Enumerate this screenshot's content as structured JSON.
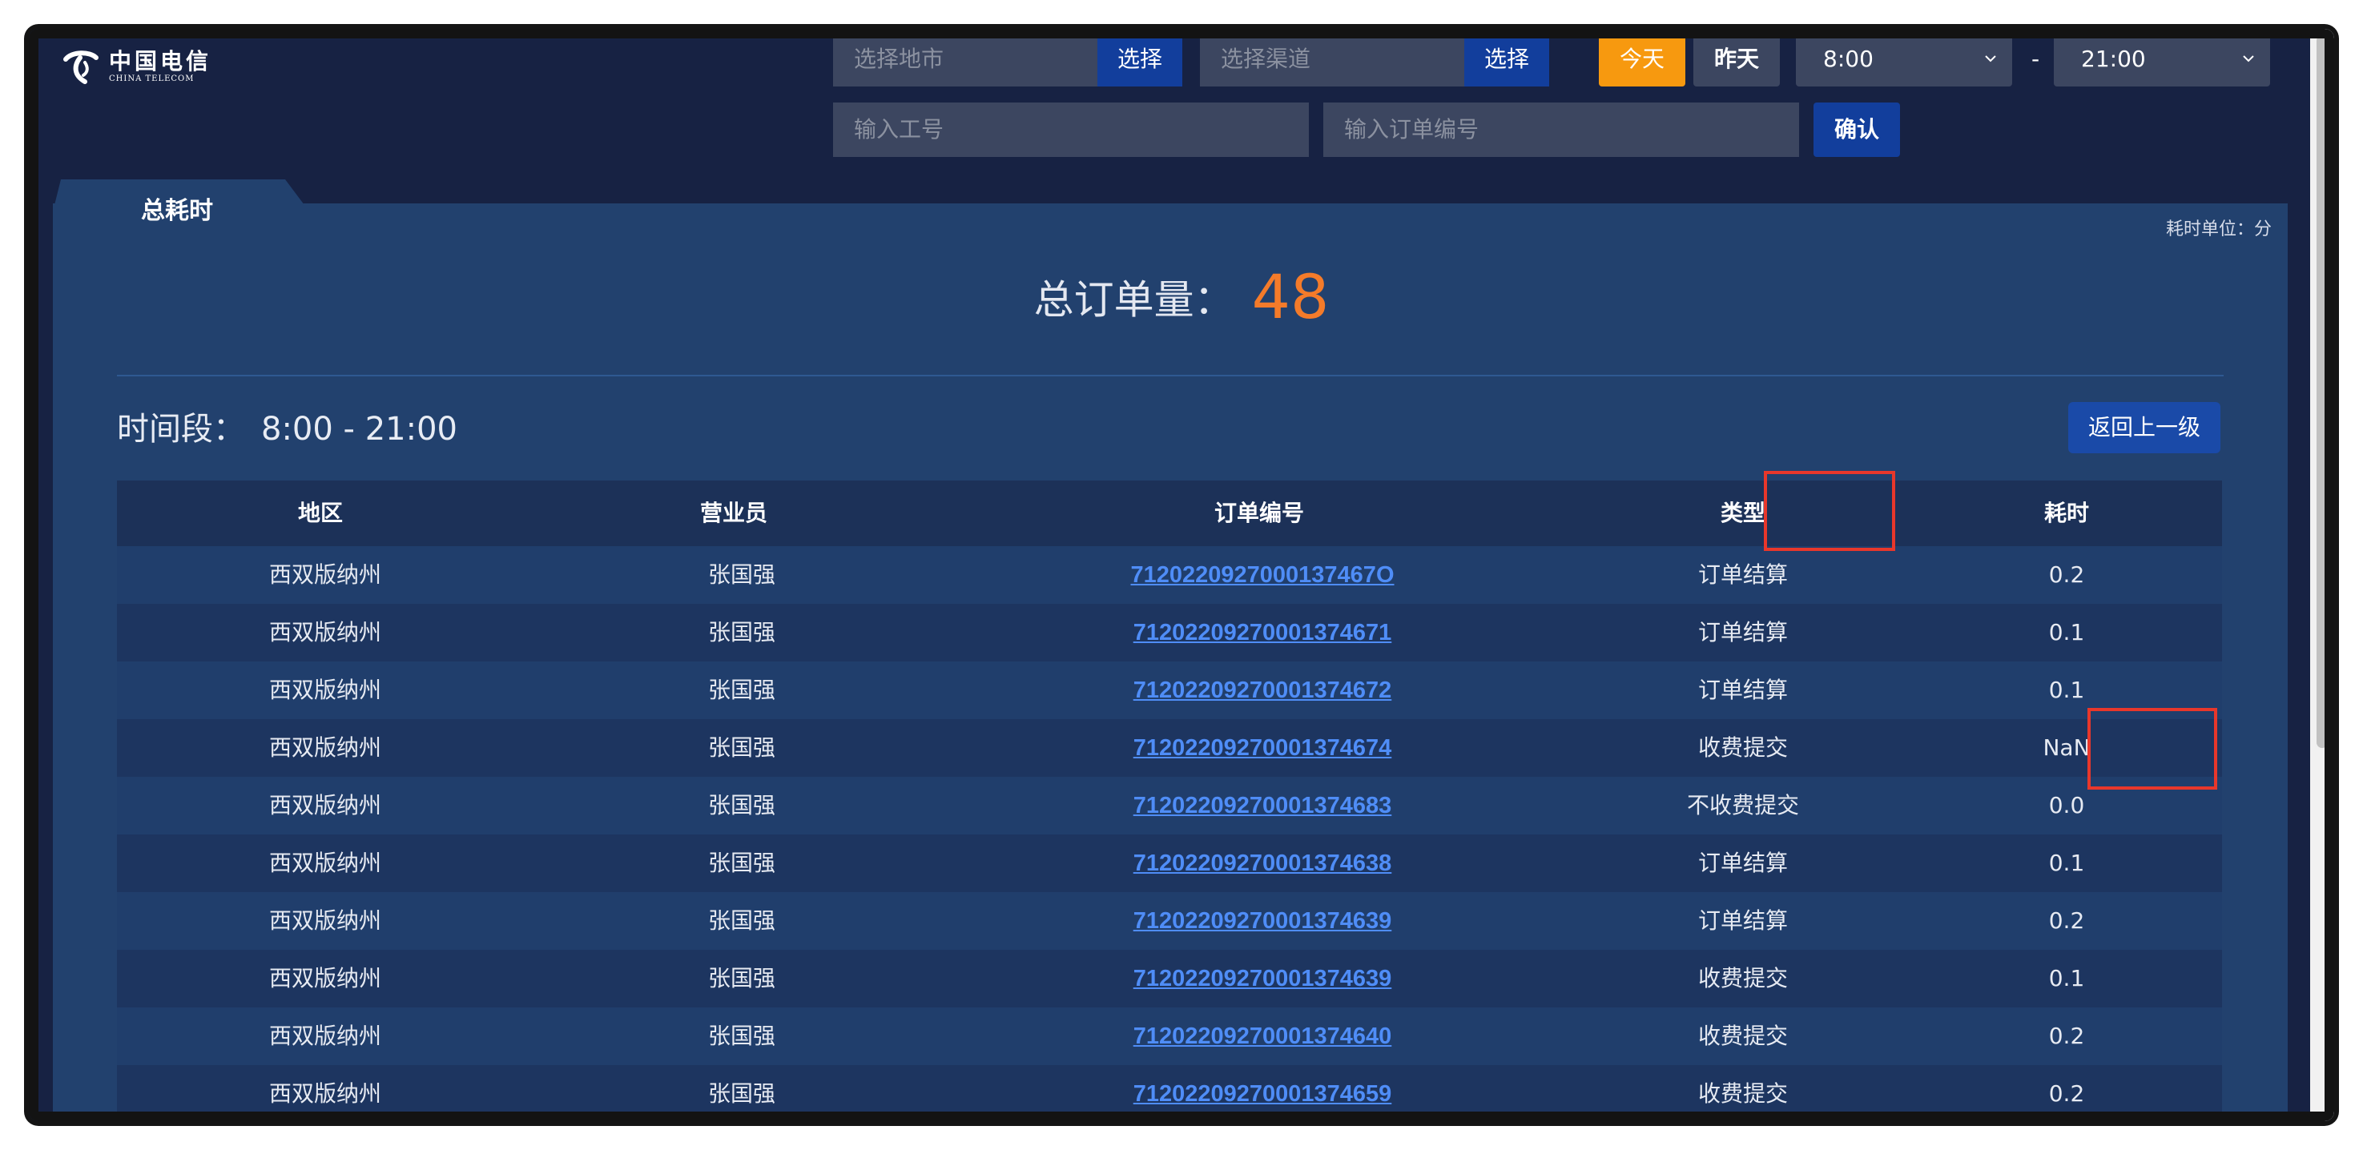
{
  "logo": {
    "cn": "中国电信",
    "en": "CHINA TELECOM"
  },
  "filters": {
    "city_placeholder": "选择地市",
    "city_button": "选择",
    "channel_placeholder": "选择渠道",
    "channel_button": "选择",
    "today": "今天",
    "yesterday": "昨天",
    "start_time": "8:00",
    "separator": "-",
    "end_time": "21:00",
    "staff_placeholder": "输入工号",
    "order_placeholder": "输入订单编号",
    "confirm": "确认"
  },
  "panel": {
    "tab": "总耗时",
    "unit": "耗时单位：分",
    "total_label": "总订单量：",
    "total_value": "48",
    "period_label": "时间段：",
    "period_value": "8:00 - 21:00",
    "back_button": "返回上一级"
  },
  "table": {
    "headers": [
      "地区",
      "营业员",
      "订单编号",
      "类型",
      "耗时"
    ],
    "rows": [
      {
        "region": "西双版纳州",
        "staff": "张国强",
        "order": "7120220927000137467O",
        "type": "订单结算",
        "time": "0.2"
      },
      {
        "region": "西双版纳州",
        "staff": "张国强",
        "order": "71202209270001374671",
        "type": "订单结算",
        "time": "0.1"
      },
      {
        "region": "西双版纳州",
        "staff": "张国强",
        "order": "71202209270001374672",
        "type": "订单结算",
        "time": "0.1"
      },
      {
        "region": "西双版纳州",
        "staff": "张国强",
        "order": "71202209270001374674",
        "type": "收费提交",
        "time": "NaN"
      },
      {
        "region": "西双版纳州",
        "staff": "张国强",
        "order": "71202209270001374683",
        "type": "不收费提交",
        "time": "0.0"
      },
      {
        "region": "西双版纳州",
        "staff": "张国强",
        "order": "71202209270001374638",
        "type": "订单结算",
        "time": "0.1"
      },
      {
        "region": "西双版纳州",
        "staff": "张国强",
        "order": "71202209270001374639",
        "type": "订单结算",
        "time": "0.2"
      },
      {
        "region": "西双版纳州",
        "staff": "张国强",
        "order": "71202209270001374639",
        "type": "收费提交",
        "time": "0.1"
      },
      {
        "region": "西双版纳州",
        "staff": "张国强",
        "order": "71202209270001374640",
        "type": "收费提交",
        "time": "0.2"
      },
      {
        "region": "西双版纳州",
        "staff": "张国强",
        "order": "71202209270001374659",
        "type": "收费提交",
        "time": "0.2"
      }
    ]
  },
  "colors": {
    "background": "#172243",
    "panel": "#22416e",
    "accent_orange": "#f47b2a",
    "today_button": "#f7990f",
    "primary_button": "#123e9c",
    "link": "#4f8df7",
    "highlight": "#e8372b"
  }
}
